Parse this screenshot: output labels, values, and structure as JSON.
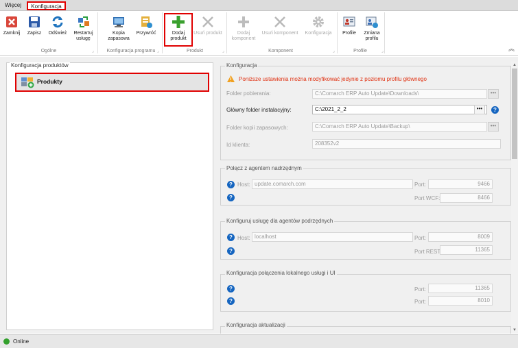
{
  "tabs": {
    "more": "Więcej",
    "config": "Konfiguracja"
  },
  "ribbon": {
    "close": "Zamknij",
    "save": "Zapisz",
    "refresh": "Odśwież",
    "restart_l1": "Restartuj",
    "restart_l2": "usługę",
    "backup_l1": "Kopia",
    "backup_l2": "zapasowa",
    "restore": "Przywróć",
    "add_product_l1": "Dodaj",
    "add_product_l2": "produkt",
    "remove_product": "Usuń produkt",
    "add_component_l1": "Dodaj",
    "add_component_l2": "komponent",
    "remove_component": "Usuń komponent",
    "component_config": "Konfiguracja",
    "profiles": "Profile",
    "change_profile_l1": "Zmiana",
    "change_profile_l2": "profilu",
    "group_general": "Ogólne",
    "group_program_config": "Konfiguracja programu",
    "group_product": "Produkt",
    "group_component": "Komponent",
    "group_profiles": "Profile"
  },
  "left": {
    "title": "Konfiguracja produktów",
    "item": "Produkty"
  },
  "config": {
    "title": "Konfiguracja",
    "warning": "Poniższe ustawienia można modyfikować jedynie z poziomu profilu głównego",
    "download_label": "Folder pobierania:",
    "download_value": "C:\\Comarch ERP Auto Update\\Downloads\\",
    "install_label": "Główny folder instalacyjny:",
    "install_value": "C:\\2021_2_2",
    "backup_label": "Folder kopii zapasowych:",
    "backup_value": "C:\\Comarch ERP Auto Update\\Backup\\",
    "client_label": "Id klienta:",
    "client_value": "208352v2",
    "dots": "•••"
  },
  "parent_agent": {
    "title": "Połącz z agentem nadrzędnym",
    "host_label": "Host:",
    "host_value": "update.comarch.com",
    "port_label": "Port:",
    "port_value": "9466",
    "portwcf_label": "Port WCF:",
    "portwcf_value": "8466"
  },
  "child_agents": {
    "title": "Konfiguruj usługę dla agentów podrzędnych",
    "host_label": "Host:",
    "host_value": "localhost",
    "port_label": "Port:",
    "port_value": "8009",
    "portrest_label": "Port REST:",
    "portrest_value": "11365"
  },
  "local_conn": {
    "title": "Konfiguracja połączenia lokalnego usługi i UI",
    "port_label": "Port:",
    "port1_value": "11365",
    "port2_value": "8010"
  },
  "update_cfg": {
    "title": "Konfiguracja aktualizacji"
  },
  "status": {
    "text": "Online"
  },
  "help_glyph": "?",
  "colors": {
    "highlight": "#e00000",
    "warning": "#e03010",
    "help": "#1565c0",
    "online": "#33a02c"
  }
}
